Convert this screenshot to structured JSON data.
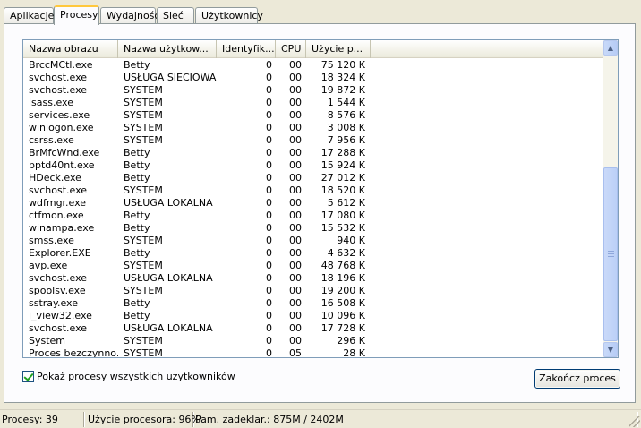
{
  "tabs": [
    {
      "label": "Aplikacje",
      "active": false
    },
    {
      "label": "Procesy",
      "active": true
    },
    {
      "label": "Wydajność",
      "active": false
    },
    {
      "label": "Sieć",
      "active": false
    },
    {
      "label": "Użytkownicy",
      "active": false
    }
  ],
  "columns": {
    "name": "Nazwa obrazu",
    "user": "Nazwa użytkow...",
    "pid": "Identyfik...",
    "cpu": "CPU",
    "mem": "Użycie p..."
  },
  "processes": [
    {
      "name": "BrccMCtl.exe",
      "user": "Betty",
      "pid": "0",
      "cpu": "00",
      "mem": "75 120 K"
    },
    {
      "name": "svchost.exe",
      "user": "USŁUGA SIECIOWA",
      "pid": "0",
      "cpu": "00",
      "mem": "18 324 K"
    },
    {
      "name": "svchost.exe",
      "user": "SYSTEM",
      "pid": "0",
      "cpu": "00",
      "mem": "19 872 K"
    },
    {
      "name": "lsass.exe",
      "user": "SYSTEM",
      "pid": "0",
      "cpu": "00",
      "mem": "1 544 K"
    },
    {
      "name": "services.exe",
      "user": "SYSTEM",
      "pid": "0",
      "cpu": "00",
      "mem": "8 576 K"
    },
    {
      "name": "winlogon.exe",
      "user": "SYSTEM",
      "pid": "0",
      "cpu": "00",
      "mem": "3 008 K"
    },
    {
      "name": "csrss.exe",
      "user": "SYSTEM",
      "pid": "0",
      "cpu": "00",
      "mem": "7 956 K"
    },
    {
      "name": "BrMfcWnd.exe",
      "user": "Betty",
      "pid": "0",
      "cpu": "00",
      "mem": "17 288 K"
    },
    {
      "name": "pptd40nt.exe",
      "user": "Betty",
      "pid": "0",
      "cpu": "00",
      "mem": "15 924 K"
    },
    {
      "name": "HDeck.exe",
      "user": "Betty",
      "pid": "0",
      "cpu": "00",
      "mem": "27 012 K"
    },
    {
      "name": "svchost.exe",
      "user": "SYSTEM",
      "pid": "0",
      "cpu": "00",
      "mem": "18 520 K"
    },
    {
      "name": "wdfmgr.exe",
      "user": "USŁUGA LOKALNA",
      "pid": "0",
      "cpu": "00",
      "mem": "5 612 K"
    },
    {
      "name": "ctfmon.exe",
      "user": "Betty",
      "pid": "0",
      "cpu": "00",
      "mem": "17 080 K"
    },
    {
      "name": "winampa.exe",
      "user": "Betty",
      "pid": "0",
      "cpu": "00",
      "mem": "15 532 K"
    },
    {
      "name": "smss.exe",
      "user": "SYSTEM",
      "pid": "0",
      "cpu": "00",
      "mem": "940 K"
    },
    {
      "name": "Explorer.EXE",
      "user": "Betty",
      "pid": "0",
      "cpu": "00",
      "mem": "4 632 K"
    },
    {
      "name": "avp.exe",
      "user": "SYSTEM",
      "pid": "0",
      "cpu": "00",
      "mem": "48 768 K"
    },
    {
      "name": "svchost.exe",
      "user": "USŁUGA LOKALNA",
      "pid": "0",
      "cpu": "00",
      "mem": "18 196 K"
    },
    {
      "name": "spoolsv.exe",
      "user": "SYSTEM",
      "pid": "0",
      "cpu": "00",
      "mem": "19 200 K"
    },
    {
      "name": "sstray.exe",
      "user": "Betty",
      "pid": "0",
      "cpu": "00",
      "mem": "16 508 K"
    },
    {
      "name": "i_view32.exe",
      "user": "Betty",
      "pid": "0",
      "cpu": "00",
      "mem": "10 096 K"
    },
    {
      "name": "svchost.exe",
      "user": "USŁUGA LOKALNA",
      "pid": "0",
      "cpu": "00",
      "mem": "17 728 K"
    },
    {
      "name": "System",
      "user": "SYSTEM",
      "pid": "0",
      "cpu": "00",
      "mem": "296 K"
    },
    {
      "name": "Proces bezczynno...",
      "user": "SYSTEM",
      "pid": "0",
      "cpu": "05",
      "mem": "28 K"
    }
  ],
  "show_all_users": {
    "label": "Pokaż procesy wszystkich użytkowników",
    "checked": true
  },
  "end_process_button": "Zakończ proces",
  "status": {
    "processes": "Procesy: 39",
    "cpu_usage": "Użycie procesora: 96%",
    "commit": "Pam. zadeklar.: 875M / 2402M"
  },
  "icons": [
    "scroll-up-icon",
    "scroll-down-icon",
    "checkmark-icon",
    "size-grip-icon"
  ]
}
